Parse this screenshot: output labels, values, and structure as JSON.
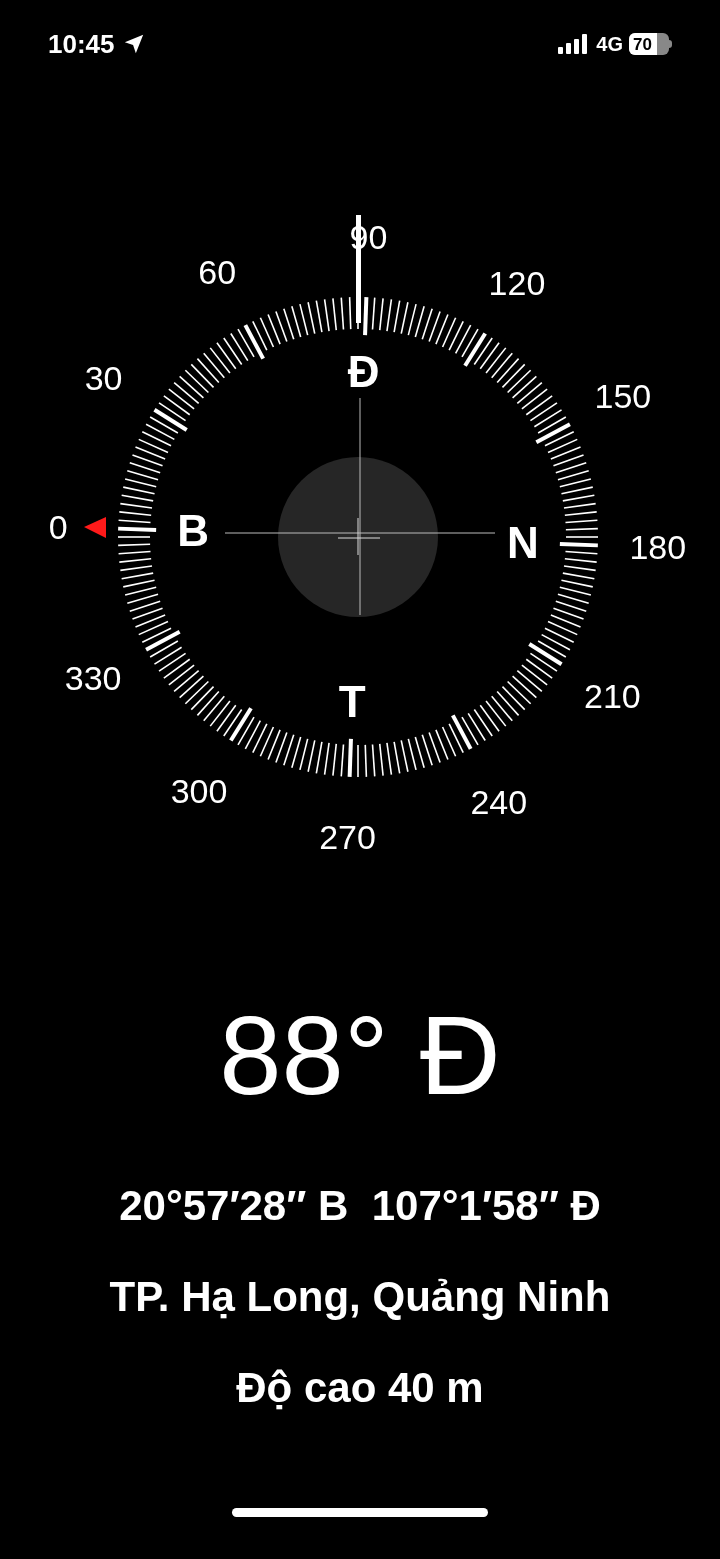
{
  "status_bar": {
    "time": "10:45",
    "network": "4G",
    "battery": "70"
  },
  "compass": {
    "degree_labels": [
      "0",
      "30",
      "60",
      "90",
      "120",
      "150",
      "180",
      "210",
      "240",
      "270",
      "300",
      "330"
    ],
    "cardinals": [
      "B",
      "Đ",
      "N",
      "T"
    ]
  },
  "heading": "88° Đ",
  "coordinates": "20°57′28″ B  107°1′58″ Đ",
  "location": "TP. Hạ Long, Quảng Ninh",
  "elevation": "Độ cao 40 m"
}
